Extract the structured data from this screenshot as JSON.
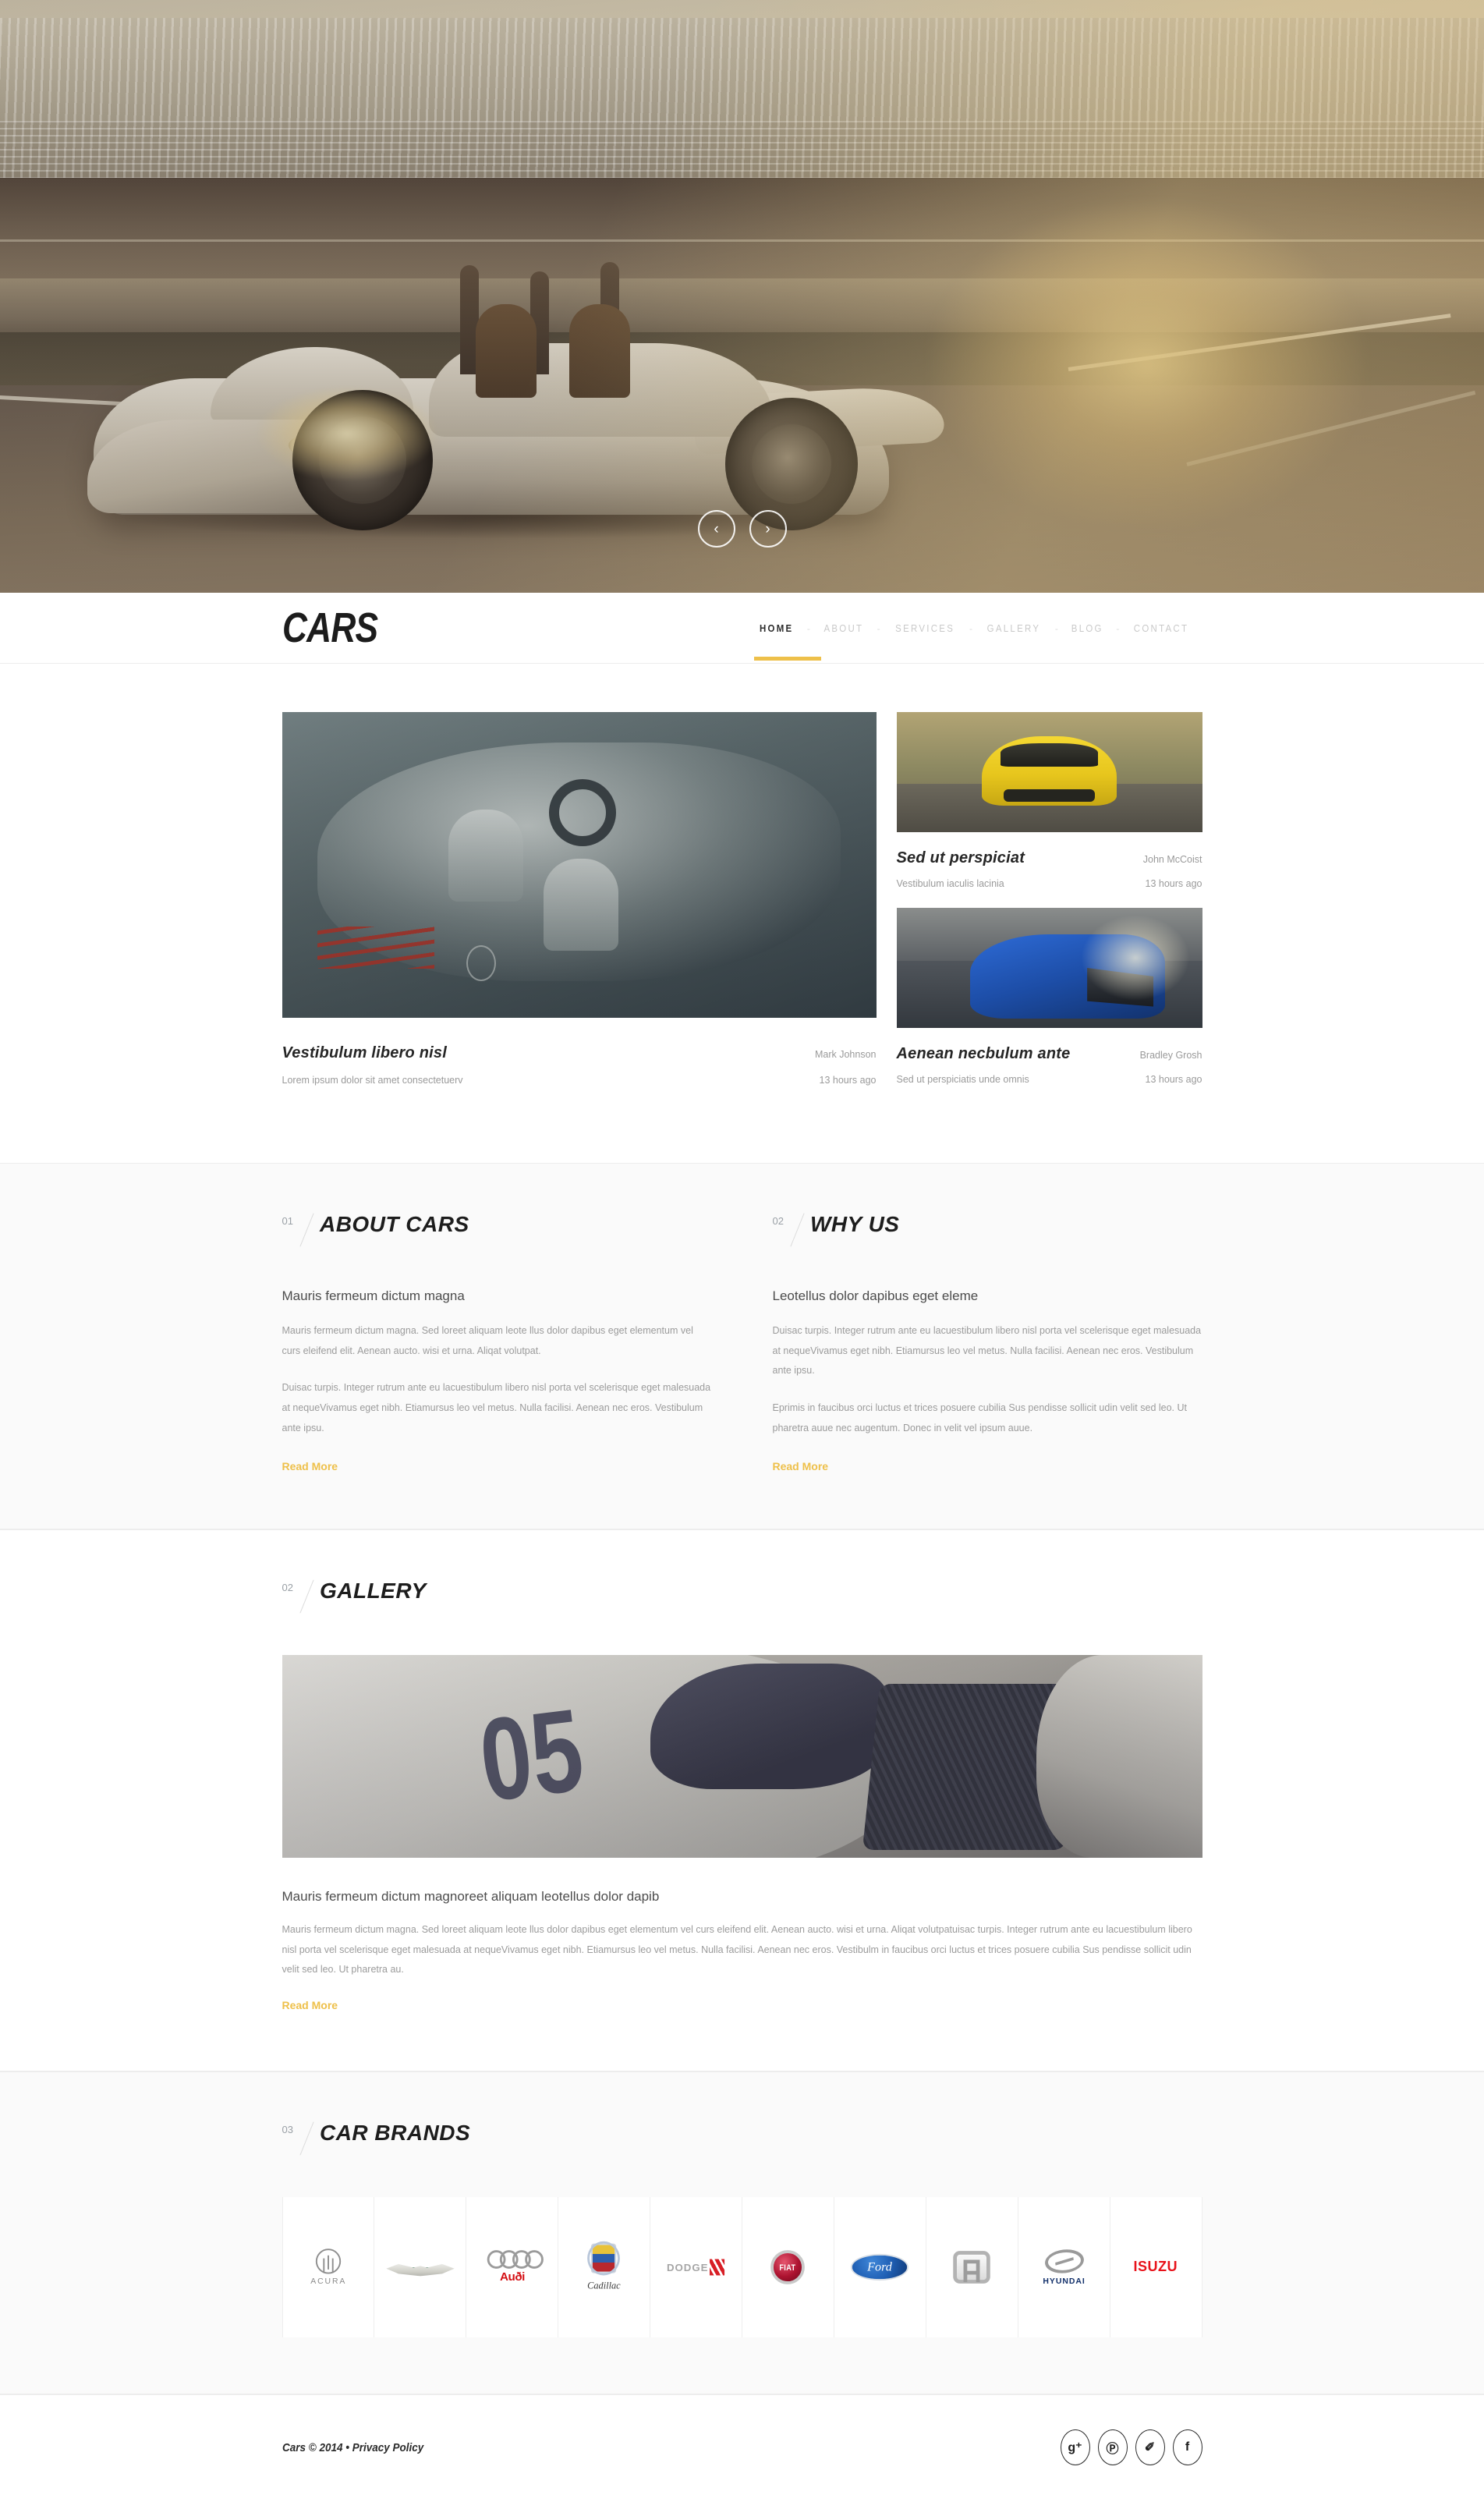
{
  "site": {
    "logo": "CARS",
    "accent_color": "#eec04a"
  },
  "nav": {
    "separator": "-",
    "items": [
      {
        "label": "HOME",
        "active": true
      },
      {
        "label": "ABOUT",
        "active": false
      },
      {
        "label": "SERVICES",
        "active": false
      },
      {
        "label": "GALLERY",
        "active": false
      },
      {
        "label": "BLOG",
        "active": false
      },
      {
        "label": "CONTACT",
        "active": false
      }
    ]
  },
  "hero": {
    "slider": {
      "prev": "‹",
      "next": "›"
    },
    "image_alt": "white open-top sports car parked on a racetrack pit lane, sepia toned"
  },
  "posts": {
    "featured": {
      "title": "Vestibulum libero nisl",
      "author": "Mark Johnson",
      "subtitle": "Lorem ipsum dolor sit amet consectetuerv",
      "time": "13 hours ago",
      "image_alt": "silver sports car cockpit interior with steering wheel and seats"
    },
    "side": [
      {
        "title": "Sed ut perspiciat",
        "author": "John McCoist",
        "subtitle": "Vestibulum iaculis lacinia",
        "time": "13 hours ago",
        "image_alt": "yellow supercar front view on mountain road"
      },
      {
        "title": "Aenean necbulum ante",
        "author": "Bradley Grosh",
        "subtitle": "Sed ut perspiciatis unde omnis",
        "time": "13 hours ago",
        "image_alt": "blue sedan front view in a tunnel"
      }
    ]
  },
  "about": {
    "number": "01",
    "title": "ABOUT CARS",
    "heading": "Mauris fermeum dictum magna",
    "paragraph1": "Mauris fermeum dictum magna. Sed loreet aliquam leote llus dolor dapibus eget elementum vel curs eleifend elit. Aenean aucto. wisi et urna. Aliqat volutpat.",
    "paragraph2": "Duisac turpis. Integer rutrum ante eu lacuestibulum libero nisl porta vel scelerisque eget malesuada at nequeVivamus eget nibh. Etiamursus leo vel metus. Nulla facilisi. Aenean nec eros. Vestibulum ante ipsu.",
    "read_more": "Read More"
  },
  "why_us": {
    "number": "02",
    "title": "WHY US",
    "heading": "Leotellus dolor dapibus eget eleme",
    "paragraph1": "Duisac turpis. Integer rutrum ante eu lacuestibulum libero nisl porta vel scelerisque eget malesuada at nequeVivamus eget nibh. Etiamursus leo vel metus. Nulla facilisi. Aenean nec eros. Vestibulum ante ipsu.",
    "paragraph2": "Eprimis in faucibus orci luctus et trices posuere cubilia Sus pendisse sollicit udin velit sed leo. Ut pharetra auue nec augentum. Donec in velit vel ipsum auue.",
    "read_more": "Read More"
  },
  "gallery": {
    "number": "02",
    "title": "GALLERY",
    "image_alt": "vintage white race car number 05 close up, desaturated",
    "heading": "Mauris fermeum dictum magnoreet aliquam leotellus dolor dapib",
    "paragraph": "Mauris fermeum dictum magna. Sed loreet aliquam leote llus dolor dapibus eget elementum vel curs eleifend elit. Aenean aucto. wisi et urna. Aliqat volutpatuisac turpis. Integer rutrum ante eu lacuestibulum libero nisl porta vel scelerisque eget malesuada at nequeVivamus eget nibh. Etiamursus leo vel metus. Nulla facilisi. Aenean nec eros. Vestibulm in faucibus orci luctus et trices posuere cubilia Sus pendisse sollicit udin velit sed leo. Ut pharetra au.",
    "read_more": "Read More"
  },
  "brands": {
    "number": "03",
    "title": "CAR BRANDS",
    "items": [
      {
        "name": "Acura",
        "wordmark": "ACURA"
      },
      {
        "name": "Aston Martin",
        "wordmark": "ASTON MARTIN"
      },
      {
        "name": "Audi",
        "wordmark": "Auði"
      },
      {
        "name": "Cadillac",
        "wordmark": "Cadillac"
      },
      {
        "name": "Dodge",
        "wordmark": "DODGE"
      },
      {
        "name": "Fiat",
        "wordmark": "FIAT"
      },
      {
        "name": "Ford",
        "wordmark": "Ford"
      },
      {
        "name": "Honda",
        "wordmark": "H"
      },
      {
        "name": "Hyundai",
        "wordmark": "HYUNDAI"
      },
      {
        "name": "Isuzu",
        "wordmark": "ISUZU"
      }
    ]
  },
  "footer": {
    "copyright": "Cars © 2014 • Privacy Policy",
    "socials": [
      {
        "name": "google-plus",
        "glyph": "g⁺"
      },
      {
        "name": "pinterest",
        "glyph": "Ⓟ"
      },
      {
        "name": "twitter",
        "glyph": "✐"
      },
      {
        "name": "facebook",
        "glyph": "f"
      }
    ]
  }
}
